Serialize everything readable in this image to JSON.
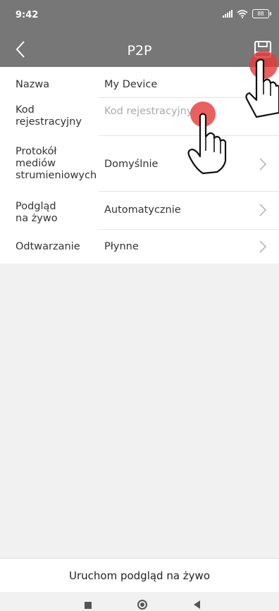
{
  "status": {
    "time": "9:42",
    "battery": "88"
  },
  "header": {
    "title": "P2P",
    "back_icon": "back-chevron-icon",
    "save_icon": "save-floppy-icon"
  },
  "form": {
    "name": {
      "label": "Nazwa",
      "value": "My Device"
    },
    "reg_code": {
      "label_line1": "Kod",
      "label_line2": "rejestracyjny",
      "placeholder": "Kod rejestracyjny",
      "value": ""
    },
    "protocol": {
      "label_line1": "Protokół",
      "label_line2": "mediów",
      "label_line3": "strumieniowych",
      "value": "Domyślnie"
    },
    "live_preview": {
      "label_line1": "Podgląd",
      "label_line2": "na żywo",
      "value": "Automatycznie"
    },
    "playback": {
      "label": "Odtwarzanie",
      "value": "Płynne"
    }
  },
  "footer": {
    "start_live_label": "Uruchom podgląd na żywo"
  },
  "colors": {
    "header_bg": "#777777",
    "tap_dot": "#e83c3c",
    "chevron": "#b0b0b0"
  }
}
